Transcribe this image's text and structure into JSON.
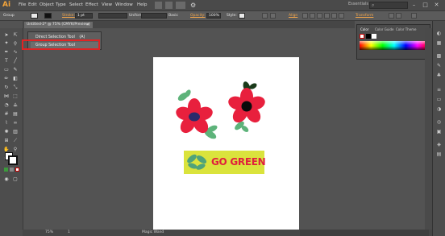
{
  "app": {
    "logo": "Ai",
    "menus": [
      "File",
      "Edit",
      "Object",
      "Type",
      "Select",
      "Effect",
      "View",
      "Window",
      "Help"
    ],
    "workspace": "Essentials",
    "window_buttons": [
      "–",
      "□",
      "✕"
    ]
  },
  "control_bar": {
    "selection_label": "Group",
    "stroke_label": "Stroke:",
    "stroke_weight": "1 pt",
    "profile": "Uniform",
    "brush": "Basic",
    "opacity_label": "Opacity:",
    "opacity_value": "100%",
    "style_label": "Style:",
    "align_label": "Align",
    "transform_label": "Transform"
  },
  "document": {
    "tab_title": "Untitled-2* @ 75% (CMYK/Preview)",
    "close_glyph": "✕"
  },
  "flyout": {
    "items": [
      {
        "label": "Direct Selection Tool",
        "shortcut": "(A)"
      },
      {
        "label": "Group Selection Tool",
        "shortcut": ""
      }
    ]
  },
  "artwork": {
    "banner_text": "GO GREEN",
    "colors": {
      "petal": "#e8203d",
      "center_purple": "#2b2b6b",
      "center_black": "#0b0b0b",
      "leaf": "#5db37a",
      "leaf_dark": "#1a3a1a",
      "banner": "#dae33c",
      "banner_text": "#e0203c"
    }
  },
  "color_panel": {
    "tabs": [
      "Color",
      "Color Guide",
      "Color Theme"
    ]
  },
  "status_bar": {
    "zoom": "75%",
    "page": "1",
    "tool_name": "Magic Wand"
  },
  "icons": {
    "tools": [
      "selection-icon",
      "direct-selection-icon",
      "magic-wand-icon",
      "lasso-icon",
      "pen-icon",
      "type-icon",
      "line-icon",
      "rectangle-icon",
      "paintbrush-icon",
      "pencil-icon",
      "eraser-icon",
      "rotate-icon",
      "scale-icon",
      "width-icon",
      "free-transform-icon",
      "shape-builder-icon",
      "perspective-icon",
      "mesh-icon",
      "gradient-icon",
      "eyedropper-icon",
      "blend-icon",
      "symbol-sprayer-icon",
      "graph-icon",
      "artboard-icon",
      "slice-icon",
      "hand-icon",
      "zoom-icon"
    ],
    "dock": [
      "color-icon",
      "color-guide-icon",
      "swatches-icon",
      "brushes-icon",
      "symbols-icon",
      "stroke-icon",
      "gradient-panel-icon",
      "transparency-icon",
      "appearance-icon",
      "graphic-styles-icon",
      "layers-icon",
      "artboards-icon"
    ]
  }
}
